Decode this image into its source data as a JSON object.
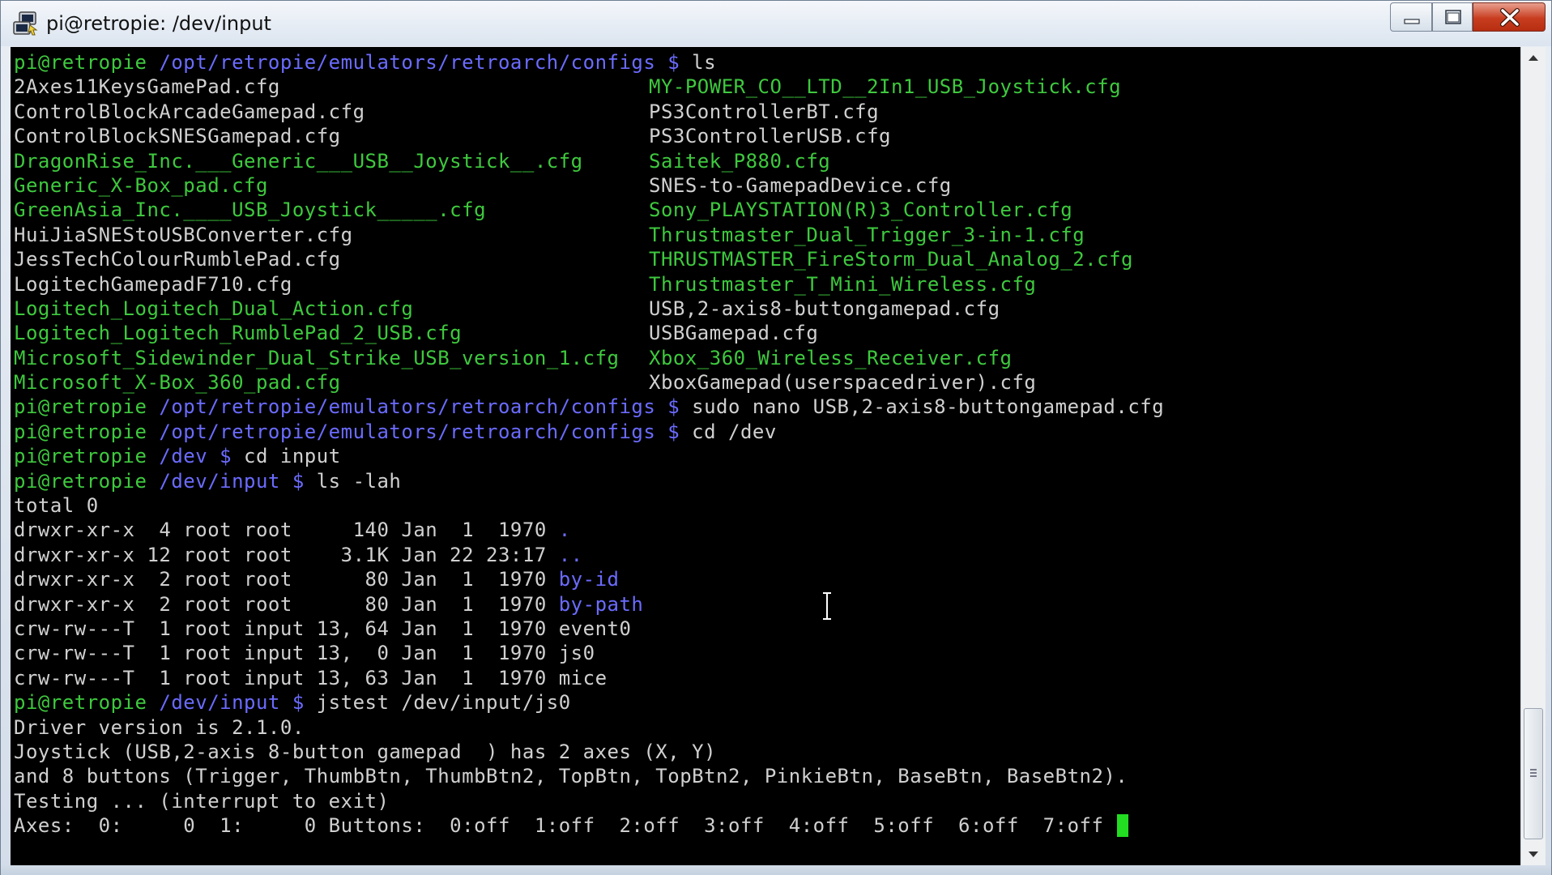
{
  "window": {
    "title": "pi@retropie: /dev/input"
  },
  "terminal": {
    "lines": [
      [
        {
          "t": "pi@retropie ",
          "c": "green"
        },
        {
          "t": "/opt/retropie/emulators/retroarch/configs $ ",
          "c": "blue"
        },
        {
          "t": "ls",
          "c": "white"
        }
      ],
      {
        "cols": [
          {
            "t": "2Axes11KeysGamePad.cfg",
            "c": "white"
          },
          {
            "t": "MY-POWER_CO__LTD__2In1_USB_Joystick.cfg",
            "c": "green"
          }
        ]
      },
      {
        "cols": [
          {
            "t": "ControlBlockArcadeGamepad.cfg",
            "c": "white"
          },
          {
            "t": "PS3ControllerBT.cfg",
            "c": "white"
          }
        ]
      },
      {
        "cols": [
          {
            "t": "ControlBlockSNESGamepad.cfg",
            "c": "white"
          },
          {
            "t": "PS3ControllerUSB.cfg",
            "c": "white"
          }
        ]
      },
      {
        "cols": [
          {
            "t": "DragonRise_Inc.___Generic___USB__Joystick__.cfg",
            "c": "green"
          },
          {
            "t": "Saitek_P880.cfg",
            "c": "green"
          }
        ]
      },
      {
        "cols": [
          {
            "t": "Generic_X-Box_pad.cfg",
            "c": "green"
          },
          {
            "t": "SNES-to-GamepadDevice.cfg",
            "c": "white"
          }
        ]
      },
      {
        "cols": [
          {
            "t": "GreenAsia_Inc.____USB_Joystick_____.cfg",
            "c": "green"
          },
          {
            "t": "Sony_PLAYSTATION(R)3_Controller.cfg",
            "c": "green"
          }
        ]
      },
      {
        "cols": [
          {
            "t": "HuiJiaSNEStoUSBConverter.cfg",
            "c": "white"
          },
          {
            "t": "Thrustmaster_Dual_Trigger_3-in-1.cfg",
            "c": "green"
          }
        ]
      },
      {
        "cols": [
          {
            "t": "JessTechColourRumblePad.cfg",
            "c": "white"
          },
          {
            "t": "THRUSTMASTER_FireStorm_Dual_Analog_2.cfg",
            "c": "green"
          }
        ]
      },
      {
        "cols": [
          {
            "t": "LogitechGamepadF710.cfg",
            "c": "white"
          },
          {
            "t": "Thrustmaster_T_Mini_Wireless.cfg",
            "c": "green"
          }
        ]
      },
      {
        "cols": [
          {
            "t": "Logitech_Logitech_Dual_Action.cfg",
            "c": "green"
          },
          {
            "t": "USB,2-axis8-buttongamepad.cfg",
            "c": "white"
          }
        ]
      },
      {
        "cols": [
          {
            "t": "Logitech_Logitech_RumblePad_2_USB.cfg",
            "c": "green"
          },
          {
            "t": "USBGamepad.cfg",
            "c": "white"
          }
        ]
      },
      {
        "cols": [
          {
            "t": "Microsoft_Sidewinder_Dual_Strike_USB_version_1.cfg",
            "c": "green"
          },
          {
            "t": "Xbox_360_Wireless_Receiver.cfg",
            "c": "green"
          }
        ]
      },
      {
        "cols": [
          {
            "t": "Microsoft_X-Box_360_pad.cfg",
            "c": "green"
          },
          {
            "t": "XboxGamepad(userspacedriver).cfg",
            "c": "white"
          }
        ]
      },
      [
        {
          "t": "pi@retropie ",
          "c": "green"
        },
        {
          "t": "/opt/retropie/emulators/retroarch/configs $ ",
          "c": "blue"
        },
        {
          "t": "sudo nano USB,2-axis8-buttongamepad.cfg",
          "c": "white"
        }
      ],
      [
        {
          "t": "pi@retropie ",
          "c": "green"
        },
        {
          "t": "/opt/retropie/emulators/retroarch/configs $ ",
          "c": "blue"
        },
        {
          "t": "cd /dev",
          "c": "white"
        }
      ],
      [
        {
          "t": "pi@retropie ",
          "c": "green"
        },
        {
          "t": "/dev $ ",
          "c": "blue"
        },
        {
          "t": "cd input",
          "c": "white"
        }
      ],
      [
        {
          "t": "pi@retropie ",
          "c": "green"
        },
        {
          "t": "/dev/input $ ",
          "c": "blue"
        },
        {
          "t": "ls -lah",
          "c": "white"
        }
      ],
      [
        {
          "t": "total 0",
          "c": "white"
        }
      ],
      [
        {
          "t": "drwxr-xr-x  4 root root     140 Jan  1  1970 ",
          "c": "white"
        },
        {
          "t": ".",
          "c": "blue"
        }
      ],
      [
        {
          "t": "drwxr-xr-x 12 root root    3.1K Jan 22 23:17 ",
          "c": "white"
        },
        {
          "t": "..",
          "c": "blue"
        }
      ],
      [
        {
          "t": "drwxr-xr-x  2 root root      80 Jan  1  1970 ",
          "c": "white"
        },
        {
          "t": "by-id",
          "c": "blue"
        }
      ],
      [
        {
          "t": "drwxr-xr-x  2 root root      80 Jan  1  1970 ",
          "c": "white"
        },
        {
          "t": "by-path",
          "c": "blue"
        }
      ],
      [
        {
          "t": "crw-rw---T  1 root input 13, 64 Jan  1  1970 event0",
          "c": "white"
        }
      ],
      [
        {
          "t": "crw-rw---T  1 root input 13,  0 Jan  1  1970 js0",
          "c": "white"
        }
      ],
      [
        {
          "t": "crw-rw---T  1 root input 13, 63 Jan  1  1970 mice",
          "c": "white"
        }
      ],
      [
        {
          "t": "pi@retropie ",
          "c": "green"
        },
        {
          "t": "/dev/input $ ",
          "c": "blue"
        },
        {
          "t": "jstest /dev/input/js0",
          "c": "white"
        }
      ],
      [
        {
          "t": "Driver version is 2.1.0.",
          "c": "white"
        }
      ],
      [
        {
          "t": "Joystick (USB,2-axis 8-button gamepad  ) has 2 axes (X, Y)",
          "c": "white"
        }
      ],
      [
        {
          "t": "and 8 buttons (Trigger, ThumbBtn, ThumbBtn2, TopBtn, TopBtn2, PinkieBtn, BaseBtn, BaseBtn2).",
          "c": "white"
        }
      ],
      [
        {
          "t": "Testing ... (interrupt to exit)",
          "c": "white"
        }
      ],
      [
        {
          "t": "Axes:  0:     0  1:     0 Buttons:  0:off  1:off  2:off  3:off  4:off  5:off  6:off  7:off ",
          "c": "white"
        }
      ]
    ],
    "cursor_line": 31
  },
  "colors": {
    "green": "#3ec93e",
    "blue": "#6b6bff",
    "white": "#d0d0d0",
    "cursor": "#22dd22",
    "background": "#000000"
  },
  "icons": {
    "app": "putty-icon",
    "minimize": "minimize-icon",
    "maximize": "maximize-icon",
    "close": "close-icon",
    "scroll_up": "scroll-up-arrow-icon",
    "scroll_down": "scroll-down-arrow-icon",
    "text_cursor": "i-beam-cursor-icon"
  }
}
